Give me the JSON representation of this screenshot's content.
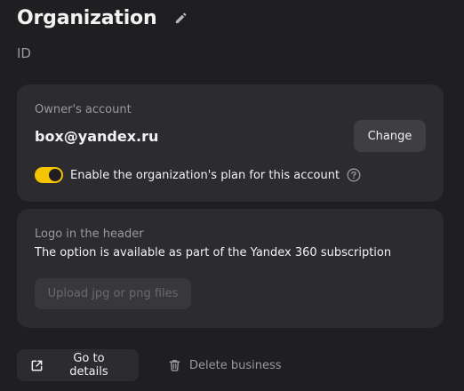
{
  "header": {
    "title": "Organization",
    "id_label": "ID",
    "edit_icon": "pencil-icon"
  },
  "owner_card": {
    "label": "Owner's account",
    "email": "box@yandex.ru",
    "change_label": "Change",
    "toggle_on": true,
    "toggle_label": "Enable the organization's plan for this account",
    "help_icon": "question-circle-icon"
  },
  "logo_card": {
    "label": "Logo in the header",
    "description": "The option is available as part of the Yandex 360 subscription",
    "upload_label": "Upload jpg or png files"
  },
  "footer": {
    "details_label": "Go to details",
    "details_icon": "external-link-icon",
    "delete_label": "Delete business",
    "delete_icon": "trash-icon"
  },
  "colors": {
    "background": "#1f1f22",
    "card": "#2c2c30",
    "accent_toggle": "#f5c400",
    "muted_text": "#9a9a9e"
  }
}
